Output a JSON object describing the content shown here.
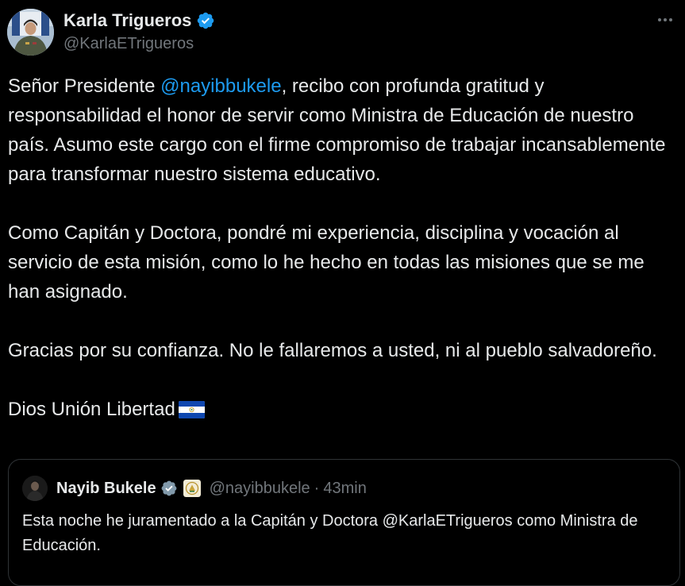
{
  "author": {
    "name": "Karla Trigueros",
    "handle": "@KarlaETrigueros",
    "verified": true,
    "avatar_icon": "military-portrait-avatar"
  },
  "menu": {
    "icon": "more-options-icon"
  },
  "tweet": {
    "paragraph1": {
      "before": "Señor Presidente ",
      "mention": "@nayibbukele",
      "after": ", recibo con profunda gratitud y responsabilidad el honor de servir como Ministra de Educación de nuestro país. Asumo este cargo con el firme compromiso de trabajar incansablemente para transformar nuestro sistema educativo."
    },
    "paragraph2": "Como Capitán y Doctora, pondré mi experiencia, disciplina y vocación al servicio de esta misión, como lo he hecho en todas las misiones que se me han asignado.",
    "paragraph3": "Gracias por su confianza. No le fallaremos a usted, ni al pueblo salvadoreño.",
    "paragraph4": "Dios Unión Libertad",
    "flag_icon": "el-salvador-flag-icon"
  },
  "quoted": {
    "name": "Nayib Bukele",
    "handle": "@nayibbukele",
    "separator": "·",
    "time": "43min",
    "verified_icon": "gray-verified-badge-icon",
    "affiliate_icon": "government-seal-icon",
    "text": "Esta noche he juramentado a la Capitán y Doctora @KarlaETrigueros como Ministra de Educación."
  },
  "colors": {
    "background": "#000000",
    "text": "#e7e9ea",
    "secondary": "#71767b",
    "link": "#1d9bf0",
    "verified_blue": "#1d9bf0",
    "verified_gray": "#829aab",
    "border": "#2f3336"
  }
}
